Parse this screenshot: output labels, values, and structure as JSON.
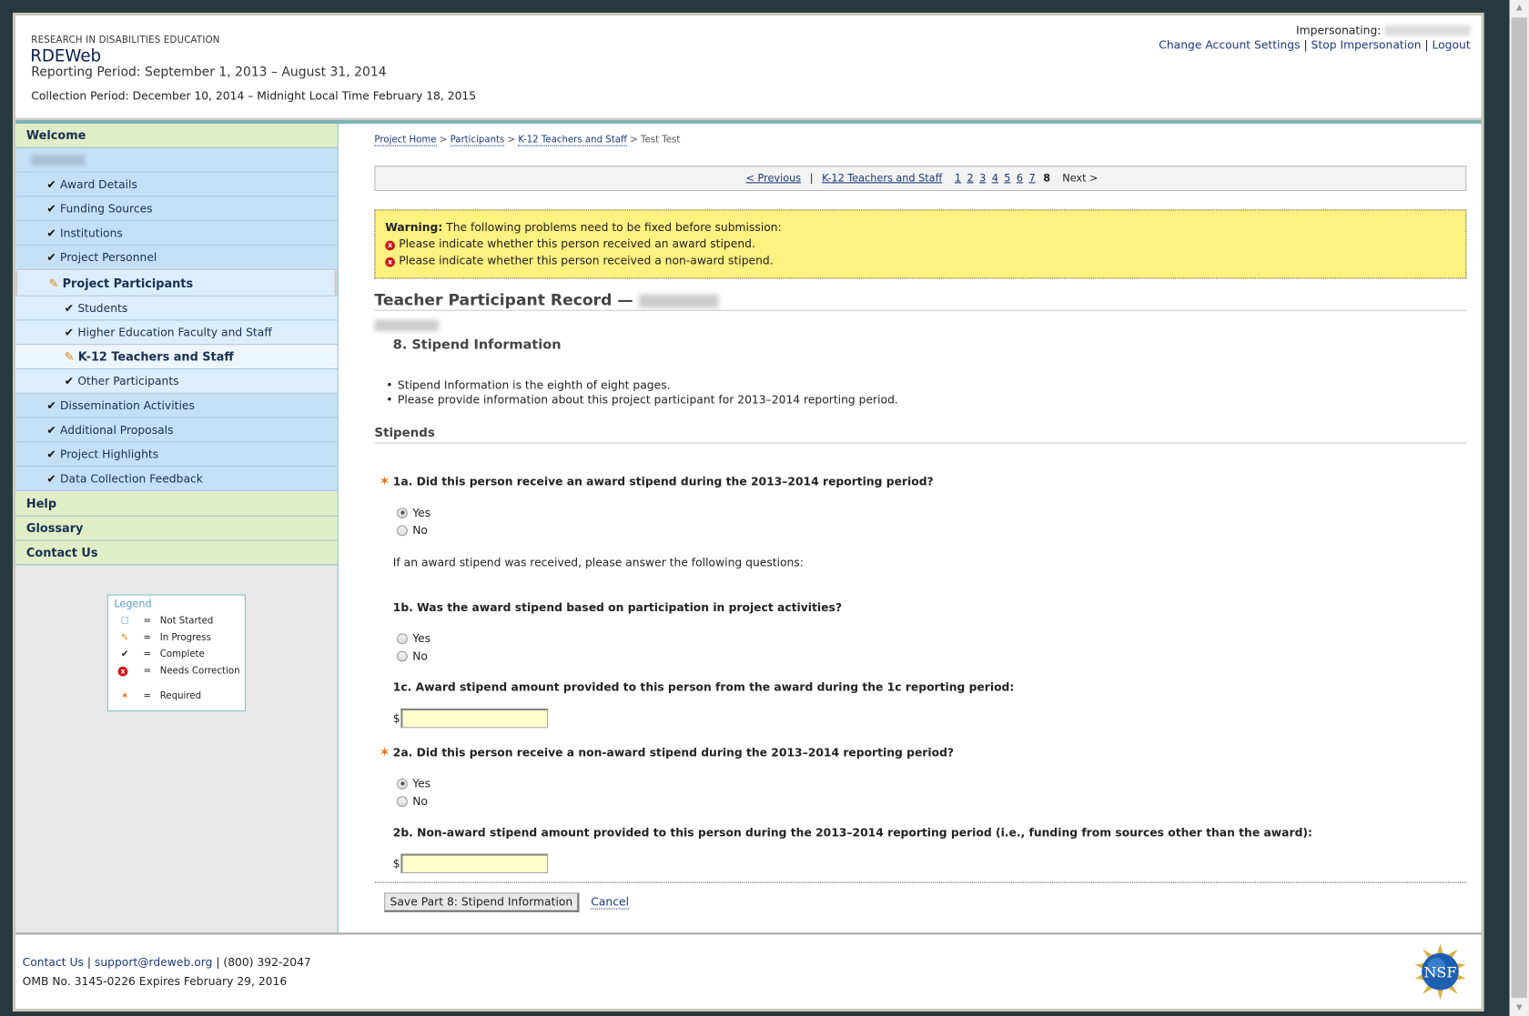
{
  "header": {
    "org": "RESEARCH IN DISABILITIES EDUCATION",
    "app_title": "RDEWeb",
    "reporting_period": "Reporting Period: September 1, 2013 – August 31, 2014",
    "collection_period": "Collection Period: December 10, 2014 – Midnight Local Time February 18, 2015",
    "impersonating_label": "Impersonating:",
    "links": {
      "account": "Change Account Settings",
      "stop": "Stop Impersonation",
      "logout": "Logout"
    },
    "sep": "|"
  },
  "sidebar": {
    "welcome": "Welcome",
    "items": [
      {
        "label": "Award Details",
        "status": "complete"
      },
      {
        "label": "Funding Sources",
        "status": "complete"
      },
      {
        "label": "Institutions",
        "status": "complete"
      },
      {
        "label": "Project Personnel",
        "status": "complete"
      },
      {
        "label": "Project Participants",
        "status": "in-progress"
      },
      {
        "label": "Students",
        "status": "complete"
      },
      {
        "label": "Higher Education Faculty and Staff",
        "status": "complete"
      },
      {
        "label": "K-12 Teachers and Staff",
        "status": "in-progress"
      },
      {
        "label": "Other Participants",
        "status": "complete"
      },
      {
        "label": "Dissemination Activities",
        "status": "complete"
      },
      {
        "label": "Additional Proposals",
        "status": "complete"
      },
      {
        "label": "Project Highlights",
        "status": "complete"
      },
      {
        "label": "Data Collection Feedback",
        "status": "complete"
      }
    ],
    "help": "Help",
    "glossary": "Glossary",
    "contact": "Contact Us"
  },
  "legend": {
    "title": "Legend",
    "eq": "=",
    "rows": [
      "Not Started",
      "In Progress",
      "Complete",
      "Needs Correction",
      "Required"
    ]
  },
  "breadcrumb": {
    "items": [
      "Project Home",
      "Participants",
      "K-12 Teachers and Staff"
    ],
    "current": "Test Test",
    "sep": ">"
  },
  "pager": {
    "previous": "< Previous",
    "section": "K-12 Teachers and Staff",
    "pages": [
      "1",
      "2",
      "3",
      "4",
      "5",
      "6",
      "7"
    ],
    "current": "8",
    "next": "Next >",
    "sep": "|"
  },
  "warning": {
    "label": "Warning:",
    "text": "The following problems need to be fixed before submission:",
    "items": [
      "Please indicate whether this person received an award stipend.",
      "Please indicate whether this person received a non-award stipend."
    ]
  },
  "record": {
    "title": "Teacher Participant Record —",
    "section": "8. Stipend Information",
    "bullets": [
      "Stipend Information is the eighth of eight pages.",
      "Please provide information about this project participant for 2013–2014 reporting period."
    ],
    "subhead": "Stipends"
  },
  "form": {
    "yes": "Yes",
    "no": "No",
    "currency": "$",
    "q1a": {
      "label": "1a. Did this person receive an award stipend during the 2013–2014 reporting period?",
      "value": "Yes"
    },
    "note": "If an award stipend was received, please answer the following questions:",
    "q1b": {
      "label": "1b. Was the award stipend based on participation in project activities?",
      "value": ""
    },
    "q1c": {
      "label": "1c. Award stipend amount provided to this person from the award during the 1c reporting period:",
      "value": ""
    },
    "q2a": {
      "label": "2a. Did this person receive a non-award stipend during the 2013–2014 reporting period?",
      "value": "Yes"
    },
    "q2b": {
      "label": "2b. Non-award stipend amount provided to this person during the 2013–2014 reporting period (i.e., funding from sources other than the award):",
      "value": ""
    },
    "save": "Save Part 8: Stipend Information",
    "cancel": "Cancel"
  },
  "footer": {
    "contact": "Contact Us",
    "email": "support@rdeweb.org",
    "phone": "(800) 392-2047",
    "sep": "|",
    "omb": "OMB No. 3145-0226 Expires February 29, 2016",
    "logo": "NSF"
  },
  "colors": {
    "accent_teal": "#7fb2b2",
    "menu_green": "#dfeec6",
    "menu_blue": "#c4e0f6",
    "warning_bg": "#fdf17f",
    "required": "#e86a10"
  }
}
